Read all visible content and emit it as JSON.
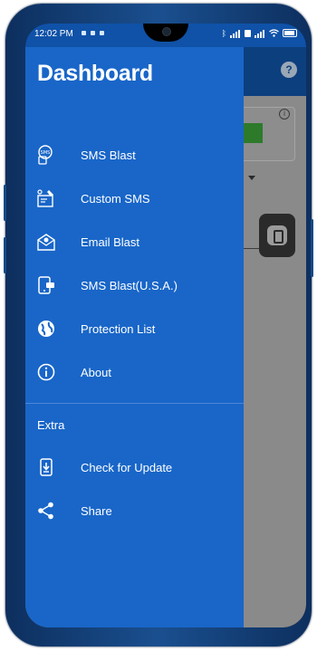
{
  "status_bar": {
    "time": "12:02 PM"
  },
  "drawer": {
    "title": "Dashboard",
    "items": [
      {
        "label": "SMS Blast",
        "icon": "sms-chat-icon"
      },
      {
        "label": "Custom SMS",
        "icon": "custom-sms-icon"
      },
      {
        "label": "Email Blast",
        "icon": "email-icon"
      },
      {
        "label": "SMS Blast(U.S.A.)",
        "icon": "phone-message-icon"
      },
      {
        "label": "Protection List",
        "icon": "globe-shield-icon"
      },
      {
        "label": "About",
        "icon": "info-icon"
      }
    ],
    "section_title": "Extra",
    "extra_items": [
      {
        "label": "Check for Update",
        "icon": "download-update-icon"
      },
      {
        "label": "Share",
        "icon": "share-icon"
      }
    ]
  },
  "appbar": {
    "help_icon": "help-icon",
    "help_glyph": "?"
  },
  "colors": {
    "drawer_bg": "#1966c8",
    "appbar_bg": "#0c3f7e",
    "phone_frame": "#1a4f8f"
  }
}
